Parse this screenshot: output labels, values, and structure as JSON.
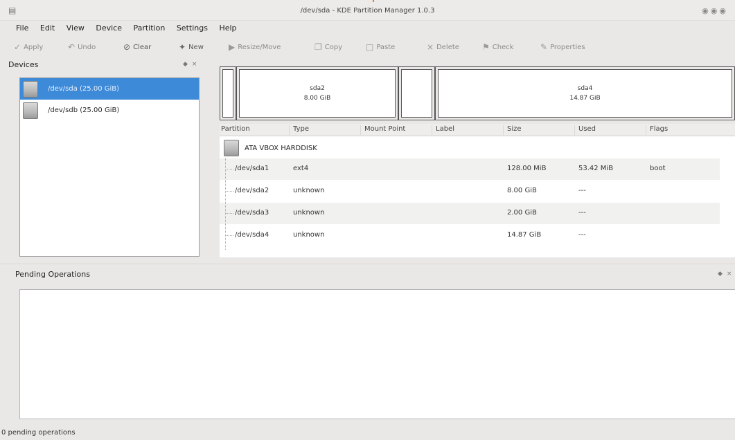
{
  "window": {
    "title": "/dev/sda - KDE Partition Manager 1.0.3",
    "app_icon": "disk-icon",
    "controls": [
      "minimize-icon",
      "maximize-icon",
      "close-icon"
    ]
  },
  "menubar": {
    "items": [
      "File",
      "Edit",
      "View",
      "Device",
      "Partition",
      "Settings",
      "Help"
    ]
  },
  "toolbar": {
    "apply": "Apply",
    "undo": "Undo",
    "clear": "Clear",
    "new": "New",
    "resize_move": "Resize/Move",
    "copy": "Copy",
    "paste": "Paste",
    "delete": "Delete",
    "check": "Check",
    "properties": "Properties"
  },
  "devices_panel": {
    "title": "Devices",
    "devices": [
      {
        "label": "/dev/sda (25.00 GiB)",
        "selected": true
      },
      {
        "label": "/dev/sdb (25.00 GiB)",
        "selected": false
      }
    ]
  },
  "partition_bar": {
    "segments": [
      {
        "name": "",
        "size": ""
      },
      {
        "name": "sda2",
        "size": "8.00 GiB"
      },
      {
        "name": "",
        "size": ""
      },
      {
        "name": "sda4",
        "size": "14.87 GiB"
      }
    ]
  },
  "partition_table": {
    "columns": [
      "Partition",
      "Type",
      "Mount Point",
      "Label",
      "Size",
      "Used",
      "Flags"
    ],
    "disk": "ATA VBOX HARDDISK",
    "rows": [
      {
        "partition": "/dev/sda1",
        "type": "ext4",
        "mount": "",
        "label": "",
        "size": "128.00 MiB",
        "used": "53.42 MiB",
        "flags": "boot"
      },
      {
        "partition": "/dev/sda2",
        "type": "unknown",
        "mount": "",
        "label": "",
        "size": "8.00 GiB",
        "used": "---",
        "flags": ""
      },
      {
        "partition": "/dev/sda3",
        "type": "unknown",
        "mount": "",
        "label": "",
        "size": "2.00 GiB",
        "used": "---",
        "flags": ""
      },
      {
        "partition": "/dev/sda4",
        "type": "unknown",
        "mount": "",
        "label": "",
        "size": "14.87 GiB",
        "used": "---",
        "flags": ""
      }
    ]
  },
  "pending_panel": {
    "title": "Pending Operations"
  },
  "statusbar": {
    "text": "0 pending operations"
  }
}
